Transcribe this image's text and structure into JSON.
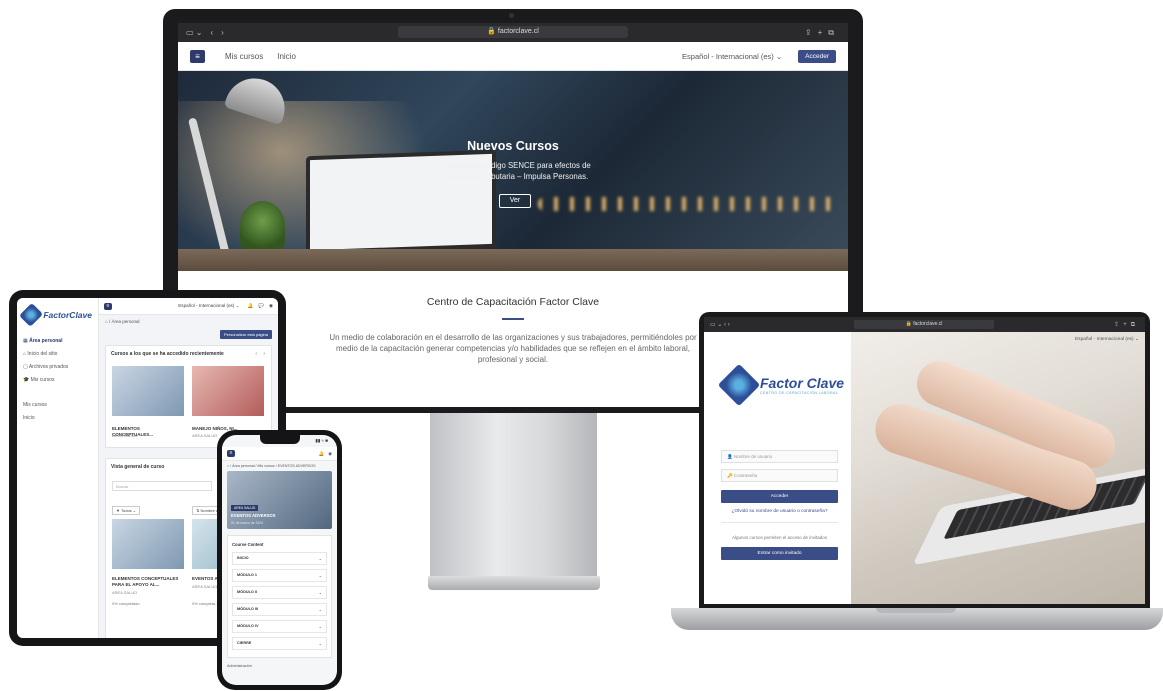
{
  "colors": {
    "brand": "#3b4d87",
    "dark_navy": "#2e3a6b",
    "logo_blue": "#2d4f9a"
  },
  "desktop": {
    "url": "factorclave.cl",
    "nav": {
      "my_courses": "Mis cursos",
      "home": "Inicio",
      "language": "Español - Internacional (es) ⌄",
      "login": "Acceder"
    },
    "hero": {
      "title": "Nuevos Cursos",
      "text": "Cursos con código SENCE para efectos de Franquicia Tributaria – Impulsa Personas.",
      "button": "Ver"
    },
    "section": {
      "title": "Centro de Capacitación Factor Clave",
      "text": "Un medio de colaboración en el desarrollo de las organizaciones y sus trabajadores, permitiéndoles por medio de la capacitación generar competencias y/o habilidades que se reflejen en el ámbito laboral, profesional y social."
    }
  },
  "tablet": {
    "logo": "FactorClave",
    "language": "Español - Internacional (es) ⌄",
    "breadcrumb": "⌂ / Área personal",
    "customize": "Personalizar esta página",
    "menu": [
      "Área personal",
      "Inicio del sitio",
      "Archivos privados",
      "Mis cursos"
    ],
    "menu_extra": [
      "Mis cursos",
      "Inicio"
    ],
    "recent": {
      "title": "Cursos a los que se ha accedido recientemente",
      "courses": [
        {
          "title": "ELEMENTOS CONCEPTUALES...",
          "sub": "AREA SALUD"
        },
        {
          "title": "MANEJO NIÑOS, NI...",
          "sub": "AREA SALUD"
        }
      ]
    },
    "overview": {
      "title": "Vista general de curso",
      "search": "Buscar",
      "filter": "▼ Todos ⌄",
      "sort": "⇅ Nombre del cu...",
      "courses": [
        {
          "title": "ELEMENTOS CONCEPTUALES PARA EL APOYO AL...",
          "sub": "AREA SALUD",
          "progress": "0% completado"
        },
        {
          "title": "EVENTOS AD...",
          "sub": "AREA SALUD",
          "progress": "0% completa..."
        }
      ]
    }
  },
  "phone": {
    "time": "▮▮ ≈ ■",
    "breadcrumb": "⌂ / Área personal / Mis cursos / EVENTOS ADVERSOS",
    "badge": "AREA SALUD",
    "course_title": "EVENTOS ADVERSOS",
    "date": "01 de marzo de 2024",
    "content_title": "Course Content",
    "sections": [
      "INICIO",
      "MÓDULO 1",
      "MÓDULO II",
      "MÓDULO III",
      "MÓDULO IV",
      "CIERRE"
    ],
    "footer": "Administración"
  },
  "laptop": {
    "url": "factorclave.cl",
    "language": "Español - Internacional (es) ⌄",
    "logo": "Factor Clave",
    "logo_sub": "CENTRO DE CAPACITACIÓN LABORAL",
    "username_placeholder": "Nombre de usuario",
    "password_placeholder": "Contraseña",
    "login": "Acceder",
    "forgot": "¿Olvidó su nombre de usuario o contraseña?",
    "guest_note": "Algunos cursos permiten el acceso de invitados",
    "guest_button": "Entrar como invitado"
  }
}
